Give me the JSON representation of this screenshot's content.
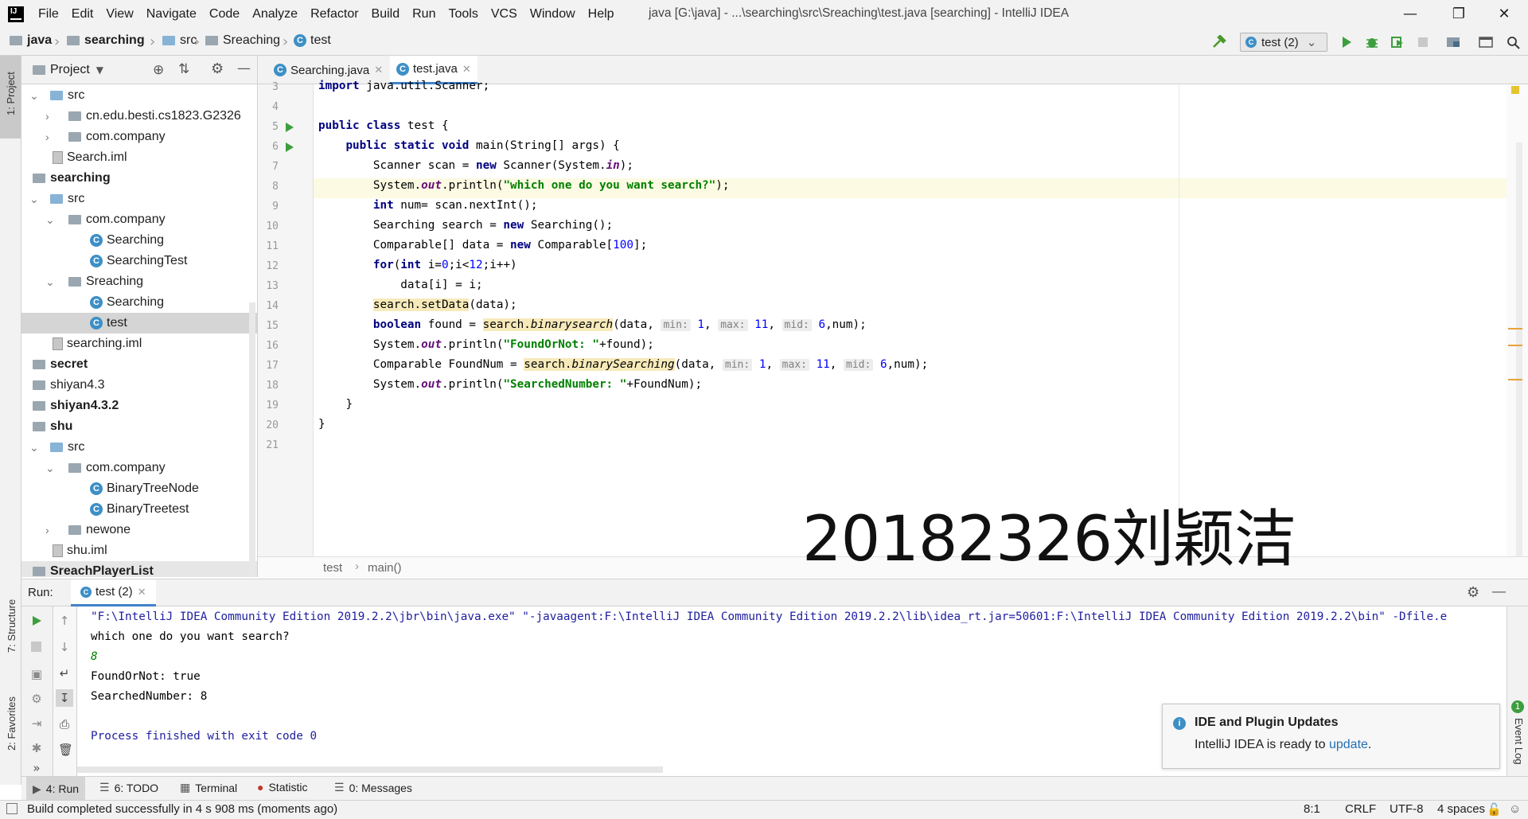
{
  "menubar": {
    "items": [
      "File",
      "Edit",
      "View",
      "Navigate",
      "Code",
      "Analyze",
      "Refactor",
      "Build",
      "Run",
      "Tools",
      "VCS",
      "Window",
      "Help"
    ],
    "window_title": "java [G:\\java] - ...\\searching\\src\\Sreaching\\test.java [searching] - IntelliJ IDEA"
  },
  "navbar": {
    "crumbs": [
      "java",
      "searching",
      "src",
      "Sreaching",
      "test"
    ],
    "run_config": "test (2)"
  },
  "left_stripe": {
    "project_tab": "1: Project",
    "structure_tab": "7: Structure",
    "favorites_tab": "2: Favorites"
  },
  "project": {
    "title": "Project",
    "tree": [
      {
        "label": "src"
      },
      {
        "label": "cn.edu.besti.cs1823.G2326"
      },
      {
        "label": "com.company"
      },
      {
        "label": "Search.iml"
      },
      {
        "label": "searching"
      },
      {
        "label": "src"
      },
      {
        "label": "com.company"
      },
      {
        "label": "Searching"
      },
      {
        "label": "SearchingTest"
      },
      {
        "label": "Sreaching"
      },
      {
        "label": "Searching"
      },
      {
        "label": "test"
      },
      {
        "label": "searching.iml"
      },
      {
        "label": "secret"
      },
      {
        "label": "shiyan4.3"
      },
      {
        "label": "shiyan4.3.2"
      },
      {
        "label": "shu"
      },
      {
        "label": "src"
      },
      {
        "label": "com.company"
      },
      {
        "label": "BinaryTreeNode"
      },
      {
        "label": "BinaryTreetest"
      },
      {
        "label": "newone"
      },
      {
        "label": "shu.iml"
      },
      {
        "label": "SreachPlayerList"
      }
    ]
  },
  "editor": {
    "tabs": [
      "Searching.java",
      "test.java"
    ],
    "line_numbers": [
      "3",
      "4",
      "5",
      "6",
      "7",
      "8",
      "9",
      "10",
      "11",
      "12",
      "13",
      "14",
      "15",
      "16",
      "17",
      "18",
      "19",
      "20",
      "21"
    ],
    "breadcrumb": [
      "test",
      "main()"
    ],
    "code": {
      "l3_kw": "import",
      "l3_rest": " java.util.Scanner;",
      "l5_kw1": "public",
      "l5_kw2": "class",
      "l5_rest": " test {",
      "l6_kw1": "public",
      "l6_kw2": "static",
      "l6_kw3": "void",
      "l6_rest": " main(String[] args) {",
      "l7_a": "Scanner scan = ",
      "l7_kw": "new",
      "l7_b": " Scanner(System.",
      "l7_fld": "in",
      "l7_c": ");",
      "l8_a": "System.",
      "l8_fld": "out",
      "l8_b": ".println(",
      "l8_str": "\"which one do you want search?\"",
      "l8_c": ");",
      "l9_kw": "int",
      "l9_rest": " num= scan.nextInt();",
      "l10_a": "Searching search = ",
      "l10_kw": "new",
      "l10_b": " Searching();",
      "l11_a": "Comparable[] data = ",
      "l11_kw": "new",
      "l11_b": " Comparable[",
      "l11_num": "100",
      "l11_c": "];",
      "l12_kw1": "for",
      "l12_a": "(",
      "l12_kw2": "int",
      "l12_b": " i=",
      "l12_num1": "0",
      "l12_c": ";i<",
      "l12_num2": "12",
      "l12_d": ";i++)",
      "l13": "data[i] = i;",
      "l14_hl": "search.setData",
      "l14_rest": "(data);",
      "l15_kw": "boolean",
      "l15_a": " found = ",
      "l15_hl1": "search.",
      "l15_hl2": "binarysearch",
      "l15_b": "(data, ",
      "l15_h1": "min:",
      "l15_n1": "1",
      "l15_h2": "max:",
      "l15_n2": "11",
      "l15_h3": "mid:",
      "l15_n3": "6",
      "l15_c": ",num);",
      "l16_a": "System.",
      "l16_fld": "out",
      "l16_b": ".println(",
      "l16_str": "\"FoundOrNot: \"",
      "l16_c": "+found);",
      "l17_a": "Comparable FoundNum = ",
      "l17_hl1": "search.",
      "l17_hl2": "binarySearching",
      "l17_b": "(data, ",
      "l17_h1": "min:",
      "l17_n1": "1",
      "l17_h2": "max:",
      "l17_n2": "11",
      "l17_h3": "mid:",
      "l17_n3": "6",
      "l17_c": ",num);",
      "l18_a": "System.",
      "l18_fld": "out",
      "l18_b": ".println(",
      "l18_str": "\"SearchedNumber: \"",
      "l18_c": "+FoundNum);",
      "l19": "}",
      "l20": "}"
    }
  },
  "watermark": "20182326刘颖洁",
  "run": {
    "label": "Run:",
    "tab": "test (2)",
    "console": [
      "\"F:\\IntelliJ IDEA Community Edition 2019.2.2\\jbr\\bin\\java.exe\" \"-javaagent:F:\\IntelliJ IDEA Community Edition 2019.2.2\\lib\\idea_rt.jar=50601:F:\\IntelliJ IDEA Community Edition 2019.2.2\\bin\" -Dfile.e",
      "which one do you want search?",
      "8",
      "FoundOrNot: true",
      "SearchedNumber: 8",
      "",
      "Process finished with exit code 0"
    ]
  },
  "notification": {
    "title": "IDE and Plugin Updates",
    "body": "IntelliJ IDEA is ready to ",
    "link": "update",
    "after": ".",
    "event_log": "Event Log",
    "event_count": "1"
  },
  "bottom_tabs": [
    "4: Run",
    "6: TODO",
    "Terminal",
    "Statistic",
    "0: Messages"
  ],
  "status": {
    "message": "Build completed successfully in 4 s 908 ms (moments ago)",
    "position": "8:1",
    "line_sep": "CRLF",
    "encoding": "UTF-8",
    "indent": "4 spaces"
  }
}
